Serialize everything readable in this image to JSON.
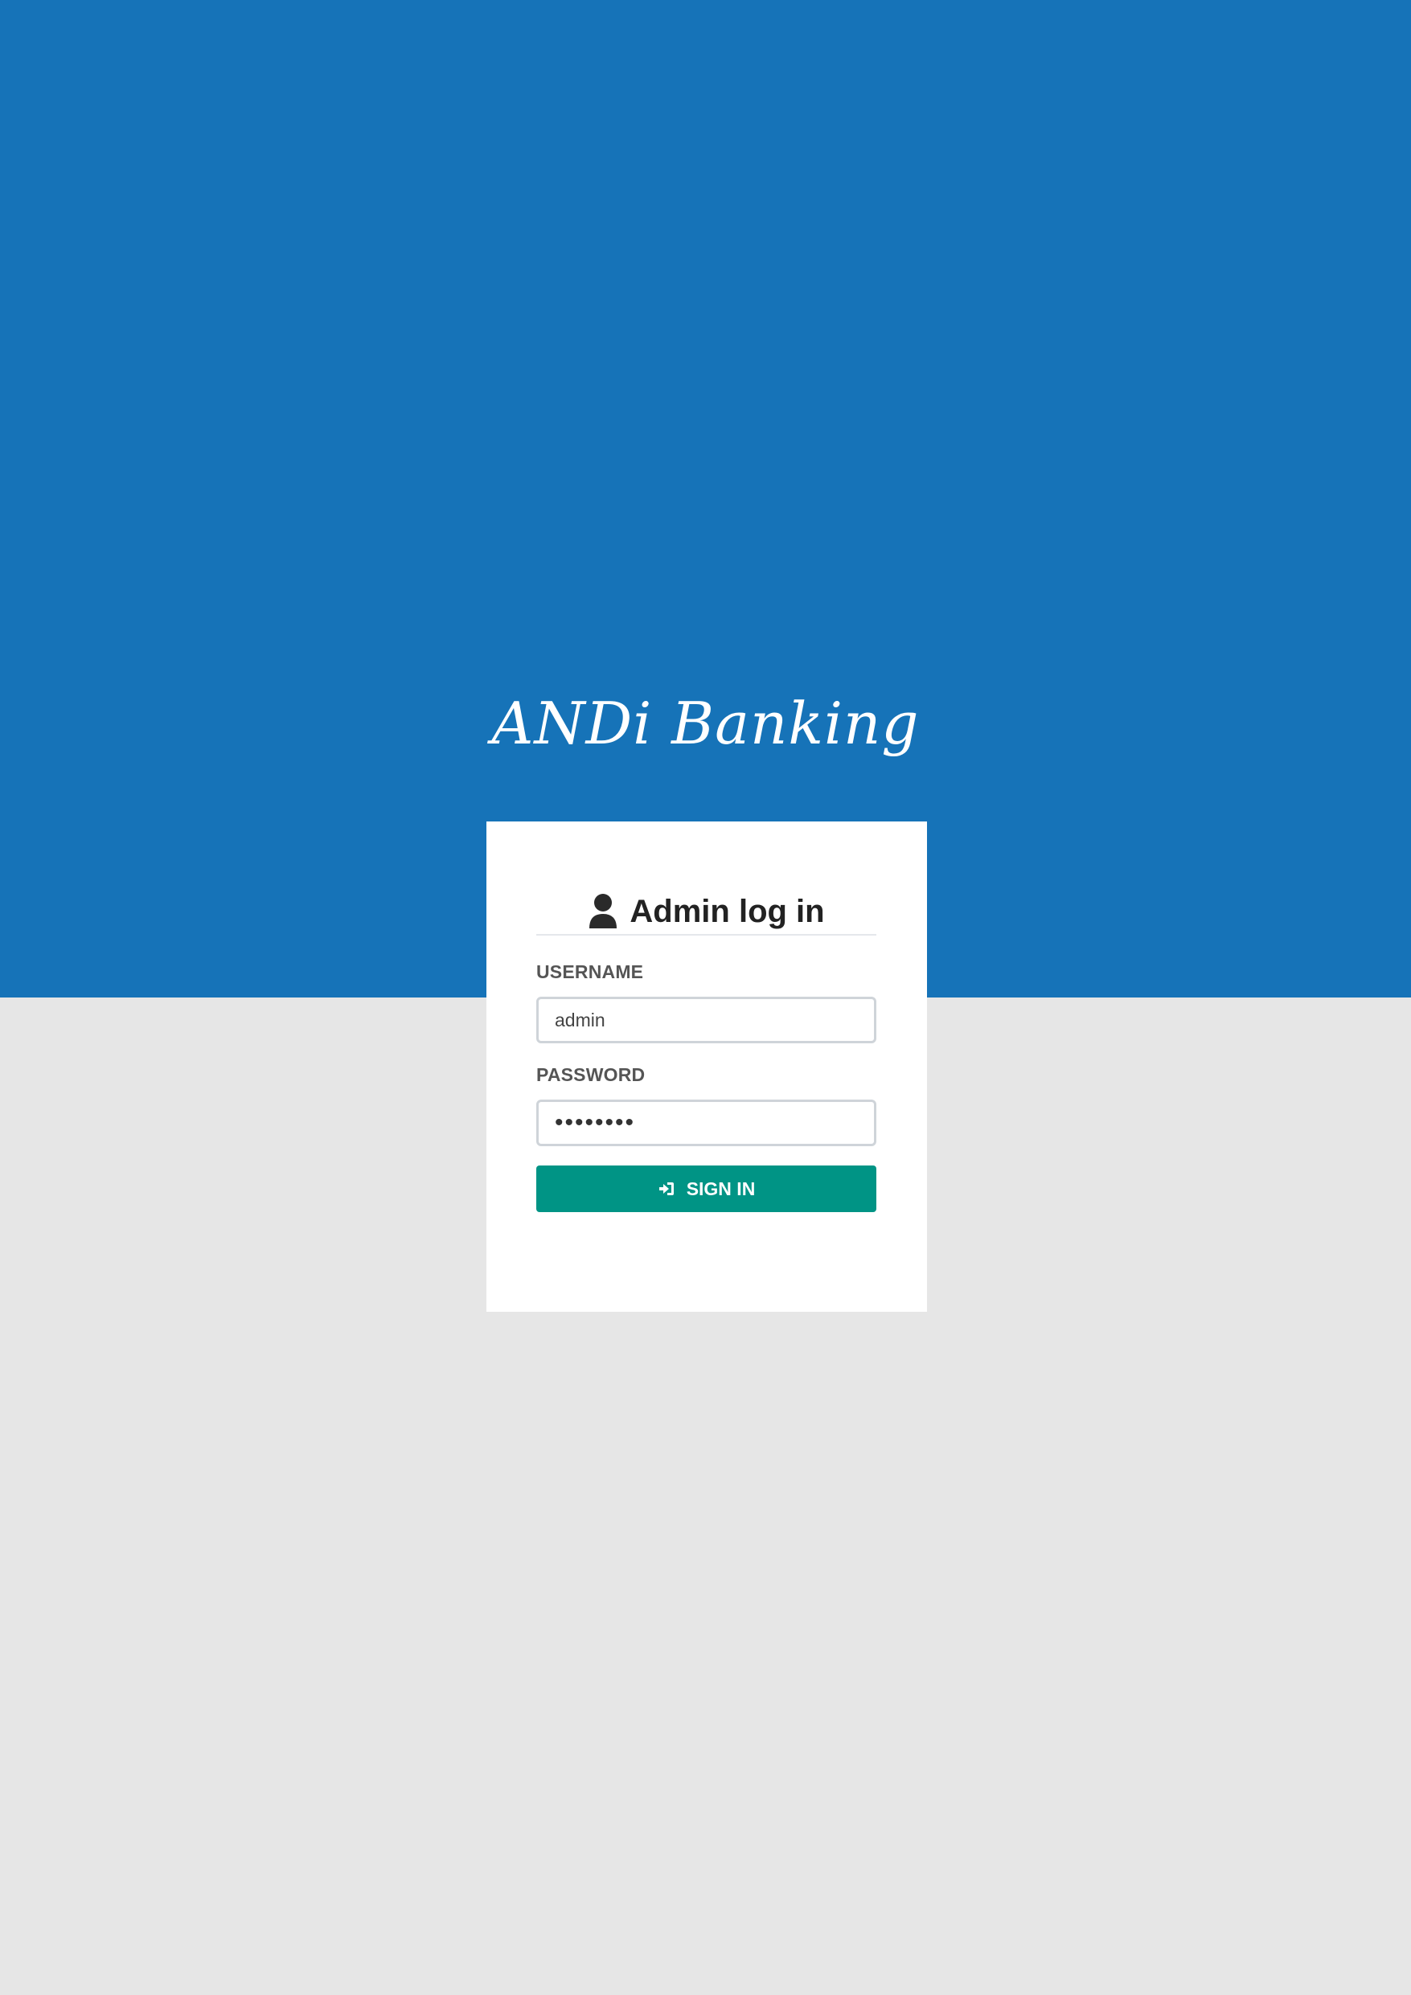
{
  "brand": {
    "name": "ANDi Banking"
  },
  "login_card": {
    "title": "Admin log in",
    "title_icon": "user-icon",
    "username": {
      "label": "USERNAME",
      "value": "admin"
    },
    "password": {
      "label": "PASSWORD",
      "value": "••••••••"
    },
    "signin": {
      "label": "SIGN IN",
      "icon": "sign-in-icon"
    }
  },
  "colors": {
    "header_blue": "#1673b8",
    "page_gray": "#e6e6e6",
    "button_teal": "#009485",
    "card_white": "#ffffff"
  }
}
